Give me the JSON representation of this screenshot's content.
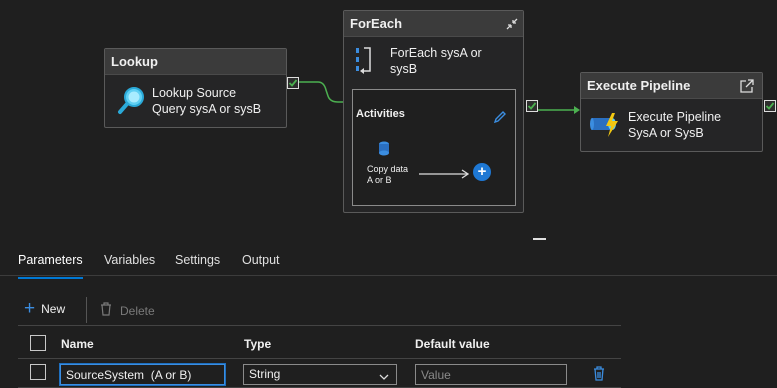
{
  "nodes": {
    "lookup": {
      "title": "Lookup",
      "line1": "Lookup Source",
      "line2": "Query sysA or sysB"
    },
    "foreach": {
      "title": "ForEach",
      "line1": "ForEach sysA or",
      "line2": "sysB",
      "activities_label": "Activities",
      "inner_line1": "Copy data",
      "inner_line2": "A or B"
    },
    "execute": {
      "title": "Execute Pipeline",
      "line1": "Execute Pipeline",
      "line2": "SysA or SysB"
    }
  },
  "tabs": [
    "Parameters",
    "Variables",
    "Settings",
    "Output"
  ],
  "toolbar": {
    "new_label": "New",
    "delete_label": "Delete"
  },
  "table": {
    "headers": {
      "name": "Name",
      "type": "Type",
      "default": "Default value"
    },
    "row": {
      "name": "SourceSystem  (A or B)",
      "type": "String",
      "default_placeholder": "Value"
    }
  },
  "colors": {
    "accent": "#0078d4",
    "success": "#4cb050",
    "delete": "#3b8de0"
  }
}
